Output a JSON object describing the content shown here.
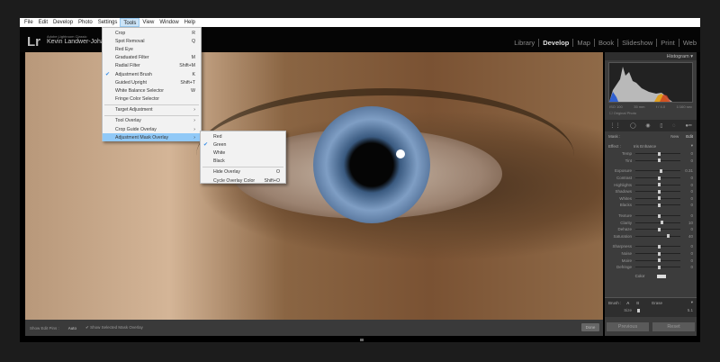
{
  "menubar": [
    "File",
    "Edit",
    "Develop",
    "Photo",
    "Settings",
    "Tools",
    "View",
    "Window",
    "Help"
  ],
  "header": {
    "logo": "Lr",
    "catalog": "Adobe Lightroom Classic",
    "user": "Kevin Landwer-Johan",
    "modules": [
      "Library",
      "Develop",
      "Map",
      "Book",
      "Slideshow",
      "Print",
      "Web"
    ],
    "active_module": "Develop"
  },
  "tools_menu": [
    {
      "label": "Crop",
      "shortcut": "R"
    },
    {
      "label": "Spot Removal",
      "shortcut": "Q"
    },
    {
      "label": "Red Eye",
      "shortcut": ""
    },
    {
      "label": "Graduated Filter",
      "shortcut": "M"
    },
    {
      "label": "Radial Filter",
      "shortcut": "Shift+M"
    },
    {
      "label": "Adjustment Brush",
      "shortcut": "K",
      "checked": true
    },
    {
      "label": "Guided Upright",
      "shortcut": "Shift+T"
    },
    {
      "label": "White Balance Selector",
      "shortcut": "W"
    },
    {
      "label": "Fringe Color Selector",
      "shortcut": ""
    },
    {
      "label": "Target Adjustment",
      "shortcut": "›"
    },
    {
      "label": "Tool Overlay",
      "shortcut": "›"
    },
    {
      "label": "Crop Guide Overlay",
      "shortcut": "›"
    },
    {
      "label": "Adjustment Mask Overlay",
      "shortcut": "›",
      "highlighted": true
    }
  ],
  "submenu": [
    {
      "label": "Red"
    },
    {
      "label": "Green",
      "checked": true
    },
    {
      "label": "White"
    },
    {
      "label": "Black"
    },
    {
      "label": "Hide Overlay",
      "shortcut": "O"
    },
    {
      "label": "Cycle Overlay Color",
      "shortcut": "Shift+O"
    }
  ],
  "toolbar": {
    "show_edit_pins": "Show Edit Pins :",
    "pins_value": "Auto",
    "show_overlay": "Show Selected Mask Overlay",
    "done": "Done"
  },
  "panel": {
    "histogram_title": "Histogram",
    "hist_info": [
      "ISO 100",
      "35 mm",
      "f / 4.0",
      "1/160 sec"
    ],
    "original_photo": "Original Photo",
    "mask": "Mask :",
    "new": "New",
    "edit": "Edit",
    "effect_label": "Effect :",
    "effect_value": "Iris Enhance",
    "sliders": [
      {
        "label": "Temp",
        "value": "0",
        "pos": 0.5
      },
      {
        "label": "Tint",
        "value": "0",
        "pos": 0.5
      },
      null,
      {
        "label": "Exposure",
        "value": "0.31",
        "pos": 0.53
      },
      {
        "label": "Contrast",
        "value": "0",
        "pos": 0.5
      },
      {
        "label": "Highlights",
        "value": "0",
        "pos": 0.5
      },
      {
        "label": "Shadows",
        "value": "0",
        "pos": 0.5
      },
      {
        "label": "Whites",
        "value": "0",
        "pos": 0.5
      },
      {
        "label": "Blacks",
        "value": "0",
        "pos": 0.5
      },
      null,
      {
        "label": "Texture",
        "value": "0",
        "pos": 0.5
      },
      {
        "label": "Clarity",
        "value": "10",
        "pos": 0.55
      },
      {
        "label": "Dehaze",
        "value": "0",
        "pos": 0.5
      },
      {
        "label": "Saturation",
        "value": "40",
        "pos": 0.7
      },
      null,
      {
        "label": "Sharpness",
        "value": "0",
        "pos": 0.5
      },
      {
        "label": "Noise",
        "value": "0",
        "pos": 0.5
      },
      {
        "label": "Moire",
        "value": "0",
        "pos": 0.5
      },
      {
        "label": "Defringe",
        "value": "0",
        "pos": 0.5
      }
    ],
    "color_label": "Color",
    "brush_label": "Brush :",
    "brush_a": "A",
    "brush_b": "B",
    "erase": "Erase",
    "size_label": "Size",
    "size_value": "5.1",
    "previous": "Previous",
    "reset": "Reset"
  }
}
